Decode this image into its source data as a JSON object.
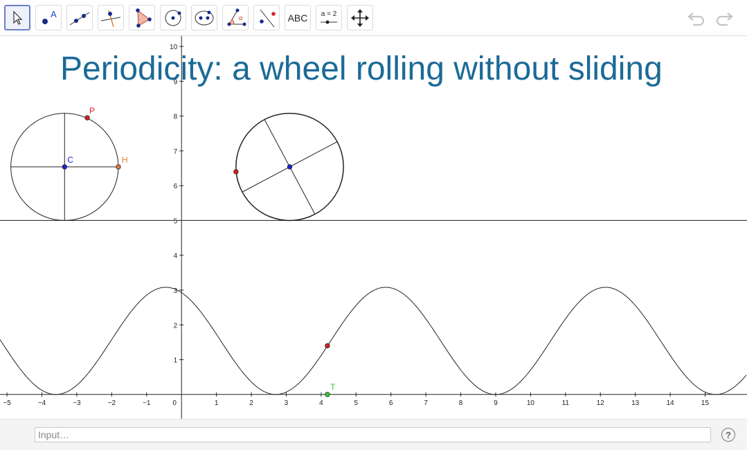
{
  "toolbar": {
    "tools": [
      {
        "name": "move-tool"
      },
      {
        "name": "point-tool",
        "label": "A"
      },
      {
        "name": "line-tool"
      },
      {
        "name": "perpendicular-line-tool"
      },
      {
        "name": "polygon-tool"
      },
      {
        "name": "circle-center-point-tool"
      },
      {
        "name": "conic-tool"
      },
      {
        "name": "angle-tool",
        "label": "α"
      },
      {
        "name": "reflect-tool"
      },
      {
        "name": "text-tool",
        "label": "ABC"
      },
      {
        "name": "slider-tool",
        "label": "a = 2"
      },
      {
        "name": "move-graphics-view-tool"
      }
    ],
    "undo_icon": "undo-icon",
    "redo_icon": "redo-icon"
  },
  "graphics": {
    "title": "Periodicity: a wheel rolling without sliding",
    "x_ticks": [
      "−5",
      "−4",
      "−3",
      "−2",
      "−1",
      "0",
      "1",
      "2",
      "3",
      "4",
      "5",
      "6",
      "7",
      "8",
      "9",
      "10",
      "11",
      "12",
      "13",
      "14",
      "15"
    ],
    "y_ticks": [
      "1",
      "2",
      "3",
      "4",
      "5",
      "6",
      "7",
      "8",
      "9",
      "10"
    ],
    "x_range": [
      -5.2,
      16.2
    ],
    "y_range": [
      -0.7,
      10.3
    ],
    "ground_line_y": 5,
    "wheel_radius": 1.54,
    "static_wheel": {
      "center_x": -3.35,
      "center_y": 6.54
    },
    "rolling_wheel": {
      "center_x": 3.1,
      "center_y": 6.54,
      "spoke_angle_deg": 28
    },
    "points": {
      "C": {
        "label": "C",
        "color": "#1a22d6"
      },
      "P": {
        "label": "P",
        "color": "#d42222",
        "x": -2.7,
        "y": 7.95
      },
      "H": {
        "label": "H",
        "color": "#e07a3c",
        "x": -1.81,
        "y": 6.54
      },
      "T": {
        "label": "T",
        "color": "#2fcf2f",
        "x": 4.18,
        "y": 0
      },
      "rolling_point": {
        "color": "#d42222",
        "x": 1.56,
        "y": 6.4
      },
      "curve_point": {
        "color": "#d42222",
        "x": 4.18,
        "y": 1.4
      }
    },
    "curve": {
      "amplitude": 1.54,
      "offset": 1.54,
      "period": 6.3,
      "phase_min_x": 2.7
    }
  },
  "input_bar": {
    "placeholder": "Input…",
    "help_icon": "help-icon",
    "help_label": "?"
  }
}
